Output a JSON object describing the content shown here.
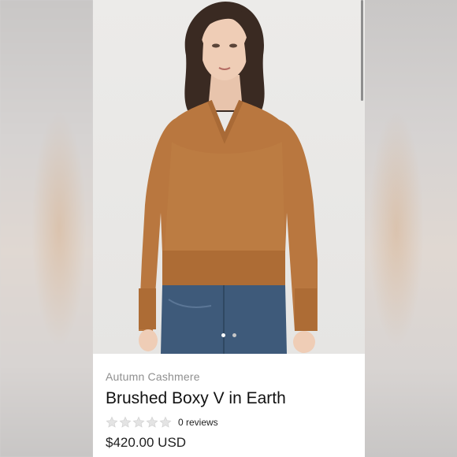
{
  "product": {
    "vendor": "Autumn Cashmere",
    "title": "Brushed Boxy V in Earth",
    "reviews": "0 reviews",
    "price": "$420.00 USD",
    "rating": 0,
    "rating_max": 5
  },
  "gallery": {
    "slide_count": 2,
    "active_slide": 1
  },
  "colors": {
    "sweater": "#b9773f",
    "jeans": "#3e5a7a",
    "background": "#ebeae8"
  },
  "icons": [
    "star-outline-icon"
  ]
}
